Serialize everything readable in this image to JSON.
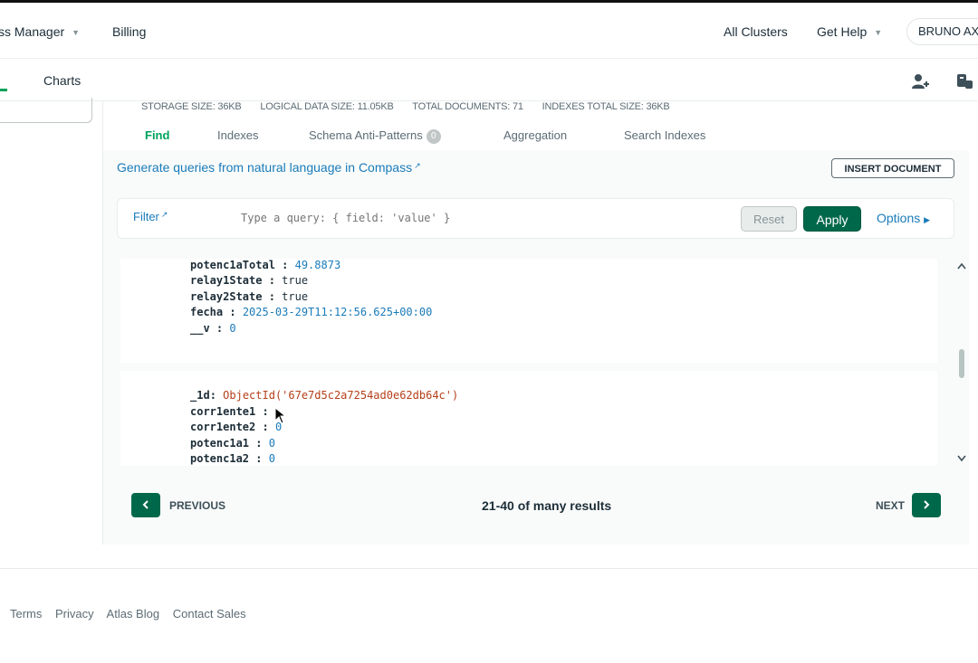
{
  "topbar": {
    "access_manager": "ss Manager",
    "billing": "Billing",
    "all_clusters": "All Clusters",
    "get_help": "Get Help",
    "user": "BRUNO AX"
  },
  "subnav": {
    "charts": "Charts"
  },
  "stats": {
    "storage": "STORAGE SIZE: 36KB",
    "logical": "LOGICAL DATA SIZE: 11.05KB",
    "total_docs": "TOTAL DOCUMENTS: 71",
    "indexes_size": "INDEXES TOTAL SIZE: 36KB"
  },
  "tabs": {
    "find": "Find",
    "indexes": "Indexes",
    "schema": "Schema Anti-Patterns",
    "schema_count": "0",
    "aggregation": "Aggregation",
    "search_indexes": "Search Indexes"
  },
  "compass_link": "Generate queries from natural language in Compass",
  "insert_document": "INSERT DOCUMENT",
  "filter": {
    "label": "Filter",
    "placeholder": "Type a query: { field: 'value' }",
    "reset": "Reset",
    "apply": "Apply",
    "options": "Options"
  },
  "documents": [
    {
      "fields": [
        {
          "key": "potenc1aTotal",
          "value": "49.8873",
          "kind": "num"
        },
        {
          "key": "relay1State",
          "value": "true",
          "kind": "bool"
        },
        {
          "key": "relay2State",
          "value": "true",
          "kind": "bool"
        },
        {
          "key": "fecha",
          "value": "2025-03-29T11:12:56.625+00:00",
          "kind": "date"
        },
        {
          "key": "__v",
          "value": "0",
          "kind": "num"
        }
      ]
    },
    {
      "fields": [
        {
          "key": "_1d",
          "value": "ObjectId('67e7d5c2a7254ad0e62db64c')",
          "kind": "oid"
        },
        {
          "key": "corr1ente1",
          "value": "",
          "kind": "num"
        },
        {
          "key": "corr1ente2",
          "value": "0",
          "kind": "num"
        },
        {
          "key": "potenc1a1",
          "value": "0",
          "kind": "num"
        },
        {
          "key": "potenc1a2",
          "value": "0",
          "kind": "num"
        }
      ]
    }
  ],
  "pagination": {
    "previous": "PREVIOUS",
    "results": "21-40 of many results",
    "next": "NEXT"
  },
  "footer": {
    "terms": "Terms",
    "privacy": "Privacy",
    "blog": "Atlas Blog",
    "contact": "Contact Sales"
  }
}
